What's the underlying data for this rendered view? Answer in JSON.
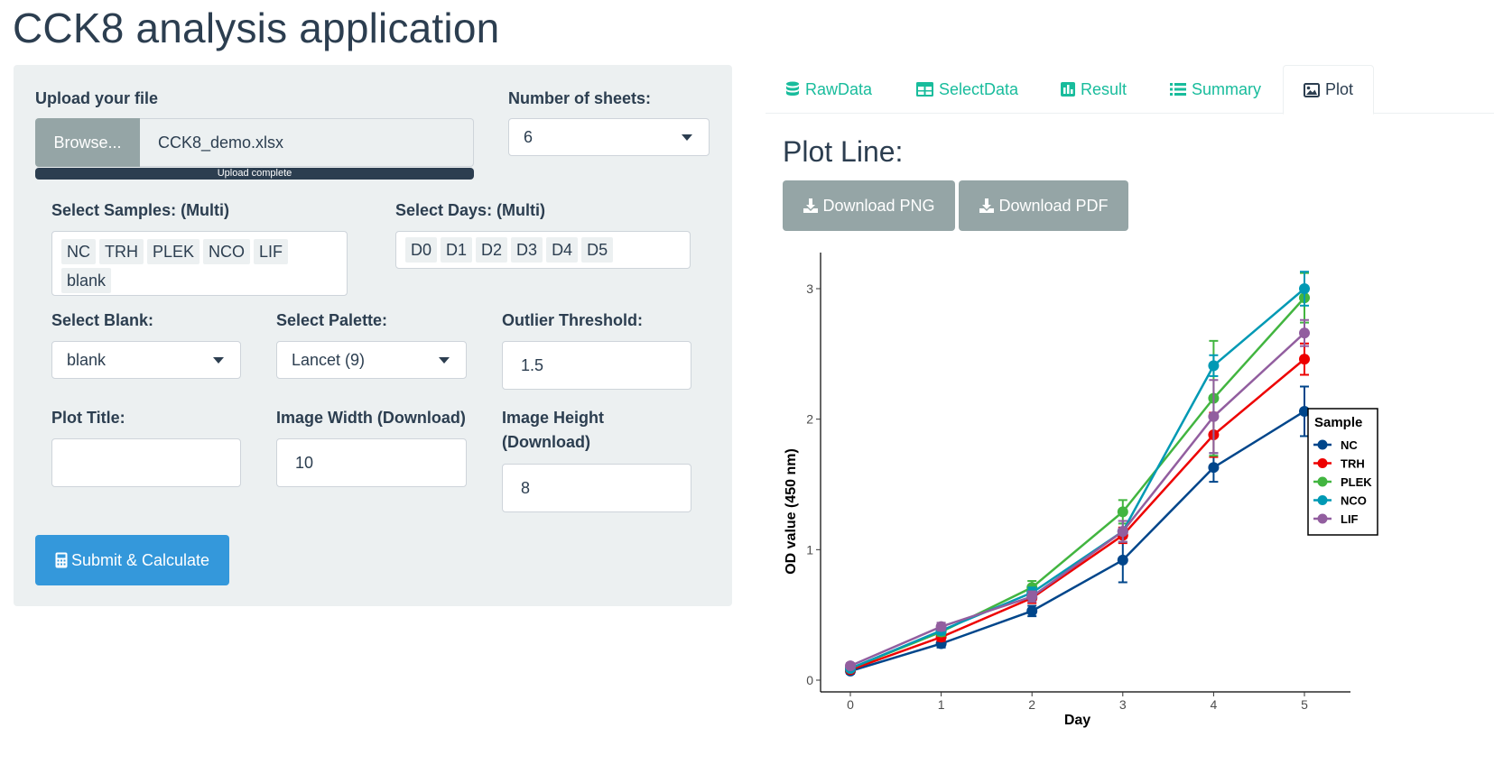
{
  "app": {
    "title": "CCK8 analysis application"
  },
  "sidebar": {
    "upload_label": "Upload your file",
    "browse_label": "Browse...",
    "file_name": "CCK8_demo.xlsx",
    "upload_status": "Upload complete",
    "sheets_label": "Number of sheets:",
    "sheets_value": "6",
    "samples_label": "Select Samples: (Multi)",
    "samples": [
      "NC",
      "TRH",
      "PLEK",
      "NCO",
      "LIF",
      "blank"
    ],
    "days_label": "Select Days: (Multi)",
    "days": [
      "D0",
      "D1",
      "D2",
      "D3",
      "D4",
      "D5"
    ],
    "blank_label": "Select Blank:",
    "blank_value": "blank",
    "palette_label": "Select Palette:",
    "palette_value": "Lancet (9)",
    "outlier_label": "Outlier Threshold:",
    "outlier_value": "1.5",
    "plot_title_label": "Plot Title:",
    "plot_title_value": "",
    "width_label": "Image Width (Download)",
    "width_value": "10",
    "height_label": "Image Height (Download)",
    "height_value": "8",
    "submit_label": "Submit & Calculate"
  },
  "tabs": [
    {
      "label": "RawData",
      "icon": "database-icon"
    },
    {
      "label": "SelectData",
      "icon": "table-icon"
    },
    {
      "label": "Result",
      "icon": "bar-chart-icon"
    },
    {
      "label": "Summary",
      "icon": "list-icon"
    },
    {
      "label": "Plot",
      "icon": "image-icon",
      "active": true
    }
  ],
  "plot": {
    "section_title": "Plot Line:",
    "download_png": "Download PNG",
    "download_pdf": "Download PDF"
  },
  "colors": {
    "primary": "#2c3e50",
    "accent": "#18bc9c",
    "button_gray": "#95a5a6",
    "button_blue": "#3498db"
  },
  "chart_data": {
    "type": "line",
    "title": "",
    "xlabel": "Day",
    "ylabel": "OD value (450 nm)",
    "x": [
      0,
      1,
      2,
      3,
      4,
      5
    ],
    "xlim": [
      0,
      5
    ],
    "ylim": [
      0,
      3
    ],
    "yticks": [
      0,
      1,
      2,
      3
    ],
    "legend_title": "Sample",
    "legend_position": "right",
    "grid": false,
    "series": [
      {
        "name": "NC",
        "color": "#00468B",
        "values": [
          0.07,
          0.28,
          0.53,
          0.92,
          1.63,
          2.06
        ],
        "err": [
          0.02,
          0.03,
          0.04,
          0.17,
          0.11,
          0.19
        ]
      },
      {
        "name": "TRH",
        "color": "#ED0000",
        "values": [
          0.08,
          0.33,
          0.63,
          1.11,
          1.88,
          2.46
        ],
        "err": [
          0.02,
          0.03,
          0.04,
          0.06,
          0.17,
          0.12
        ]
      },
      {
        "name": "PLEK",
        "color": "#42B540",
        "values": [
          0.09,
          0.37,
          0.71,
          1.29,
          2.16,
          2.93
        ],
        "err": [
          0.02,
          0.03,
          0.05,
          0.09,
          0.44,
          0.19
        ]
      },
      {
        "name": "NCO",
        "color": "#0099B4",
        "values": [
          0.09,
          0.38,
          0.67,
          1.14,
          2.41,
          3.0
        ],
        "err": [
          0.02,
          0.03,
          0.04,
          0.08,
          0.08,
          0.13
        ]
      },
      {
        "name": "LIF",
        "color": "#925E9F",
        "values": [
          0.11,
          0.41,
          0.64,
          1.14,
          2.02,
          2.66
        ],
        "err": [
          0.02,
          0.03,
          0.04,
          0.08,
          0.28,
          0.1
        ]
      }
    ]
  }
}
